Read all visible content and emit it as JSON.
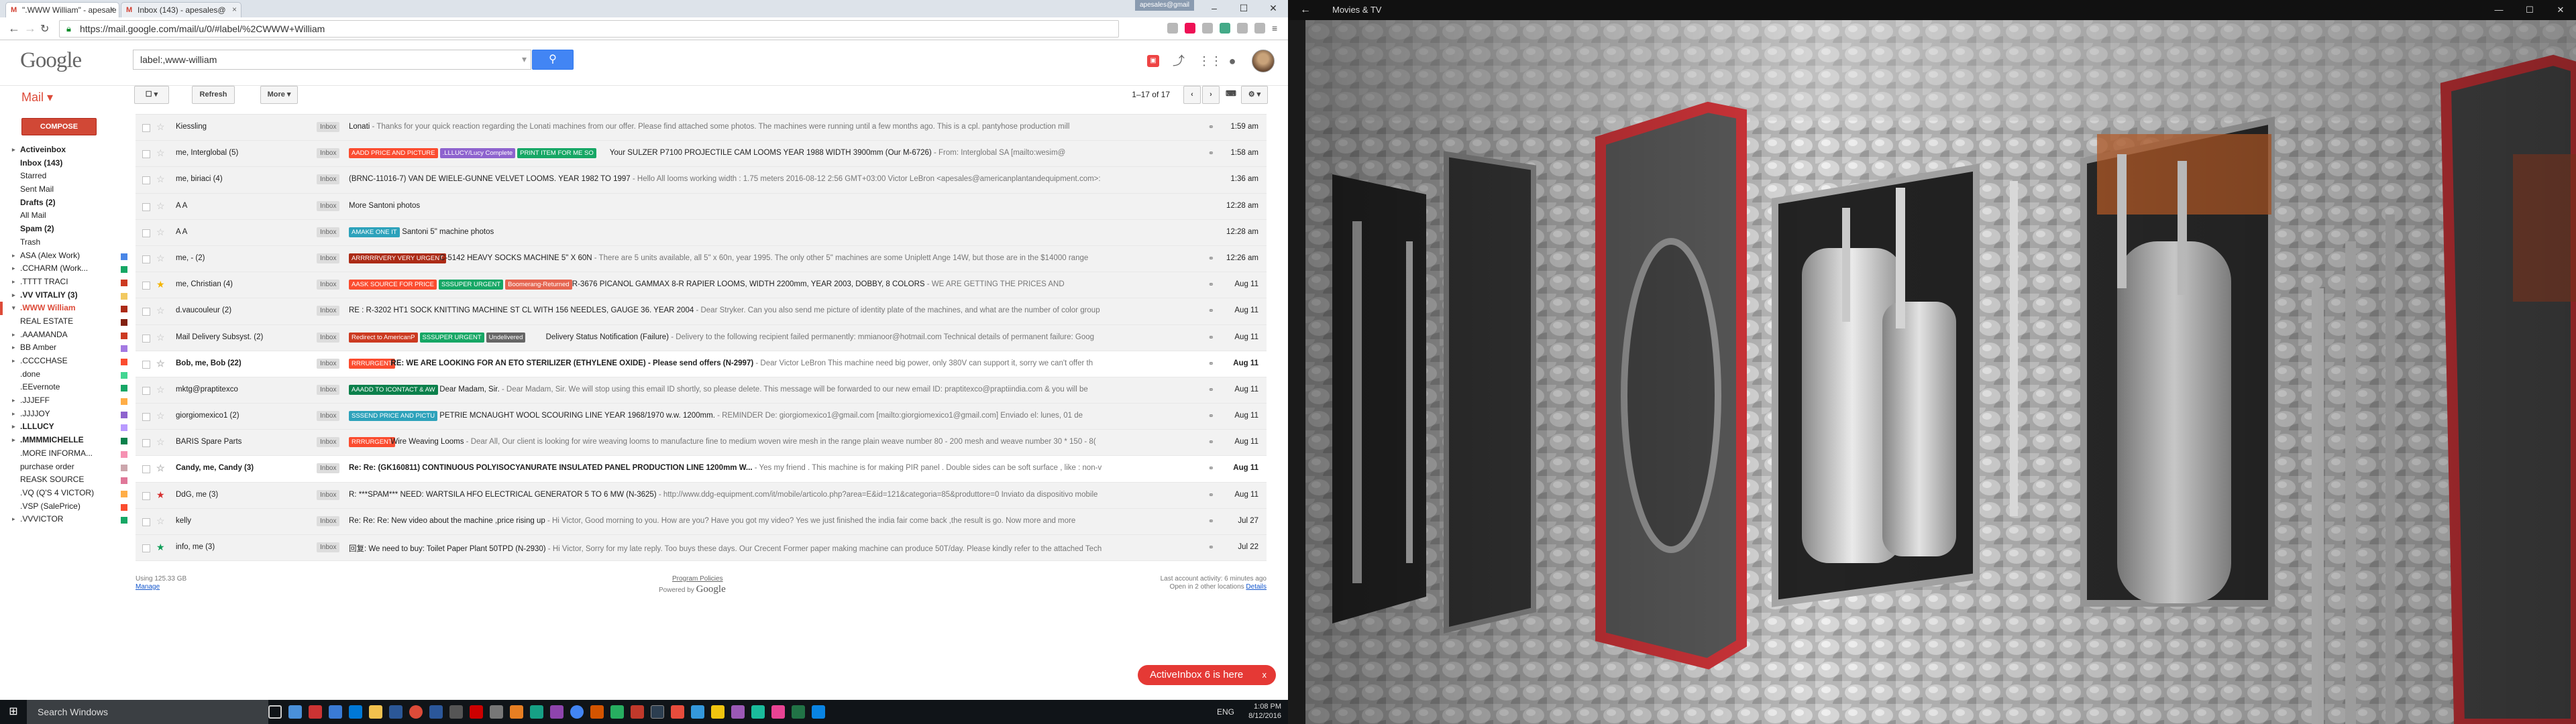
{
  "browser": {
    "tabs": [
      {
        "title": "\".WWW William\" - apesale"
      },
      {
        "title": "Inbox (143) - apesales@"
      }
    ],
    "profile_label": "apesales@gmail",
    "url": "https://mail.google.com/mail/u/0/#label/%2CWWW+William"
  },
  "gmail": {
    "logo": "Google",
    "search_value": "label:,www-william",
    "mail_label": "Mail",
    "compose_label": "COMPOSE",
    "toolbar": {
      "refresh_label": "Refresh",
      "more_label": "More",
      "pager_text": "1–17 of 17"
    },
    "nav": [
      {
        "label": "Activeinbox",
        "cls": "toggle",
        "caret": "▸",
        "color": ""
      },
      {
        "label": "Inbox (143)",
        "cls": "bold",
        "caret": "",
        "color": ""
      },
      {
        "label": "Starred",
        "cls": "",
        "caret": "",
        "color": ""
      },
      {
        "label": "Sent Mail",
        "cls": "",
        "caret": "",
        "color": ""
      },
      {
        "label": "Drafts (2)",
        "cls": "bold",
        "caret": "",
        "color": ""
      },
      {
        "label": "All Mail",
        "cls": "",
        "caret": "",
        "color": ""
      },
      {
        "label": "Spam (2)",
        "cls": "bold",
        "caret": "",
        "color": ""
      },
      {
        "label": "Trash",
        "cls": "",
        "caret": "",
        "color": ""
      },
      {
        "label": "ASA (Alex Work)",
        "cls": "lbl",
        "caret": "▸",
        "color": "#4986e7"
      },
      {
        "label": ".CCHARM (Work...",
        "cls": "lbl",
        "caret": "▸",
        "color": "#16a765"
      },
      {
        "label": ".TTTT TRACI",
        "cls": "lbl",
        "caret": "▸",
        "color": "#cc3a21"
      },
      {
        "label": ".VV VITALIY (3)",
        "cls": "bold",
        "caret": "▸",
        "color": "#f2c960"
      },
      {
        "label": ".WWW William",
        "cls": "sel",
        "caret": "▾",
        "color": "#ac2b16"
      },
      {
        "label": "REAL ESTATE",
        "cls": "lbl",
        "caret": "",
        "color": "#822111"
      },
      {
        "label": ".AAAMANDA",
        "cls": "lbl",
        "caret": "▸",
        "color": "#cc3a21"
      },
      {
        "label": "BB Amber",
        "cls": "lbl",
        "caret": "▸",
        "color": "#a479e2"
      },
      {
        "label": ".CCCCHASE",
        "cls": "lbl",
        "caret": "▸",
        "color": "#fb4c2f"
      },
      {
        "label": ".done",
        "cls": "lbl",
        "caret": "",
        "color": "#42d692"
      },
      {
        "label": ".EEvernote",
        "cls": "lbl",
        "caret": "",
        "color": "#16a766"
      },
      {
        "label": ".JJJEFF",
        "cls": "lbl",
        "caret": "▸",
        "color": "#ffad46"
      },
      {
        "label": ".JJJJOY",
        "cls": "lbl",
        "caret": "▸",
        "color": "#8e63ce"
      },
      {
        "label": ".LLLUCY",
        "cls": "bold",
        "caret": "▸",
        "color": "#b99aff"
      },
      {
        "label": ".MMMMICHELLE",
        "cls": "bold",
        "caret": "▸",
        "color": "#0b804b"
      },
      {
        "label": ".MORE INFORMA...",
        "cls": "lbl",
        "caret": "",
        "color": "#f691b2"
      },
      {
        "label": "purchase order",
        "cls": "lbl",
        "caret": "",
        "color": "#cca6ac"
      },
      {
        "label": "REASK SOURCE",
        "cls": "lbl",
        "caret": "",
        "color": "#e07798"
      },
      {
        "label": ".VQ (Q'S 4 VICTOR)",
        "cls": "lbl",
        "caret": "",
        "color": "#ffad47"
      },
      {
        "label": ".VSP (SalePrice)",
        "cls": "lbl",
        "caret": "",
        "color": "#fb4c2f"
      },
      {
        "label": ".VVVICTOR",
        "cls": "lbl",
        "caret": "▸",
        "color": "#16a765"
      }
    ],
    "emails": [
      {
        "from": "Kiessling",
        "unread": false,
        "star": "",
        "labels": [],
        "subject": "Lonati",
        "snippet": " - Thanks for your quick reaction regarding the Lonati machines from our offer. Please find attached some photos. The machines were running until a few months ago. This is a cpl. pantyhose production mill",
        "clip": true,
        "date": "1:59 am"
      },
      {
        "from": "me, Interglobal (5)",
        "unread": false,
        "star": "",
        "labels": [
          {
            "t": "AADD PRICE AND PICTURE",
            "c": "#fb4c2f"
          },
          {
            "t": ".LLLUCY/Lucy Complete",
            "c": "#8e63ce"
          },
          {
            "t": "PRINT ITEM FOR ME SO",
            "c": "#16a765"
          }
        ],
        "subject": "Your SULZER P7100 PROJECTILE CAM LOOMS YEAR 1988 WIDTH 3900mm (Our M-6726)",
        "snippet": " - From: Interglobal SA [mailto:wesim@",
        "clip": true,
        "date": "1:58 am"
      },
      {
        "from": "me, biriaci (4)",
        "unread": false,
        "star": "",
        "labels": [],
        "subject": "(BRNC-11016-7) VAN DE WIELE-GUNNE VELVET LOOMS. YEAR 1982 TO 1997",
        "snippet": " - Hello All looms working width : 1.75 meters 2016-08-12 2:56 GMT+03:00 Victor LeBron <apesales@americanplantandequipment.com>:",
        "clip": false,
        "date": "1:36 am"
      },
      {
        "from": "A A",
        "unread": false,
        "star": "",
        "labels": [],
        "subject": "More Santoni photos",
        "snippet": "",
        "clip": false,
        "date": "12:28 am"
      },
      {
        "from": "A A",
        "unread": false,
        "star": "",
        "labels": [
          {
            "t": "AMAKE ONE IT",
            "c": "#2da2bb"
          }
        ],
        "subject": "Santoni 5\" machine photos",
        "snippet": "",
        "clip": false,
        "date": "12:28 am"
      },
      {
        "from": "me, - (2)",
        "unread": false,
        "star": "",
        "labels": [
          {
            "t": "ARRRRRVERY VERY URGENT",
            "c": "#ac2b16"
          }
        ],
        "subject": "C-5142 HEAVY SOCKS MACHINE 5\" X 60N",
        "snippet": " - There are 5 units available, all 5\" x 60n, year 1995. The only other 5\" machines are some Uniplett Ange 14W, but those are in the $14000 range",
        "clip": true,
        "date": "12:26 am"
      },
      {
        "from": "me, Christian (4)",
        "unread": false,
        "star": "yellow",
        "labels": [
          {
            "t": "AASK SOURCE FOR PRICE",
            "c": "#fb4c2f"
          },
          {
            "t": "SSSUPER URGENT",
            "c": "#16a765"
          },
          {
            "t": "Boomerang-Returned",
            "c": "#e66550"
          }
        ],
        "subject": "R-3676 PICANOL GAMMAX 8-R RAPIER LOOMS, WIDTH 2200mm, YEAR 2003, DOBBY, 8 COLORS",
        "snippet": " - WE ARE GETTING THE PRICES AND",
        "clip": true,
        "date": "Aug 11"
      },
      {
        "from": "d.vaucouleur (2)",
        "unread": false,
        "star": "",
        "labels": [],
        "subject": "RE : R-3202 HT1 SOCK KNITTING MACHINE ST CL WITH 156 NEEDLES, GAUGE 36. YEAR 2004",
        "snippet": " - Dear Stryker. Can you also send me picture of identity plate of the machines, and what are the number of color group",
        "clip": true,
        "date": "Aug 11"
      },
      {
        "from": "Mail Delivery Subsyst. (2)",
        "unread": false,
        "star": "",
        "labels": [
          {
            "t": "Redirect to AmericanP",
            "c": "#cc3a21"
          },
          {
            "t": "SSSUPER URGENT",
            "c": "#16a765"
          },
          {
            "t": "Undelivered",
            "c": "#666666"
          }
        ],
        "subject": "Delivery Status Notification (Failure)",
        "snippet": " - Delivery to the following recipient failed permanently: mmianoor@hotmail.com Technical details of permanent failure: Goog",
        "clip": true,
        "date": "Aug 11"
      },
      {
        "from": "Bob, me, Bob (22)",
        "unread": true,
        "star": "",
        "labels": [
          {
            "t": "RRRURGENT",
            "c": "#fb4c2f"
          }
        ],
        "subject": "RE: WE ARE LOOKING FOR AN ETO STERILIZER (ETHYLENE OXIDE) - Please send offers (N-2997)",
        "snippet": " - Dear Victor LeBron This machine need big power, only 380V can support it, sorry we can't offer th",
        "clip": true,
        "date": "Aug 11"
      },
      {
        "from": "mktg@praptitexco",
        "unread": false,
        "star": "",
        "labels": [
          {
            "t": "AAADD TO ICONTACT & AW",
            "c": "#0b804b"
          }
        ],
        "subject": "Dear Madam, Sir.",
        "snippet": " - Dear Madam, Sir. We will stop using this email ID shortly, so please delete. This message will be forwarded to our new email ID: praptitexco@praptiindia.com & you will be",
        "clip": true,
        "date": "Aug 11"
      },
      {
        "from": "giorgiomexico1 (2)",
        "unread": false,
        "star": "",
        "labels": [
          {
            "t": "SSSEND PRICE AND PICTU",
            "c": "#2da2bb"
          }
        ],
        "subject": "PETRIE MCNAUGHT WOOL SCOURING LINE YEAR 1968/1970 w.w. 1200mm.",
        "snippet": " - REMINDER De: giorgiomexico1@gmail.com [mailto:giorgiomexico1@gmail.com] Enviado el: lunes, 01 de",
        "clip": true,
        "date": "Aug 11"
      },
      {
        "from": "BARIS Spare Parts",
        "unread": false,
        "star": "",
        "labels": [
          {
            "t": "RRRURGENT",
            "c": "#fb4c2f"
          }
        ],
        "subject": "Wire Weaving Looms",
        "snippet": " - Dear All, Our client is looking for wire weaving looms to manufacture fine to medium woven wire mesh in the range plain weave number 80 - 200 mesh and weave number 30 * 150 - 8(",
        "clip": true,
        "date": "Aug 11"
      },
      {
        "from": "Candy, me, Candy (3)",
        "unread": true,
        "star": "",
        "labels": [],
        "subject": "Re: Re: (GK160811) CONTINUOUS POLYISOCYANURATE INSULATED PANEL PRODUCTION LINE 1200mm W...",
        "snippet": " - Yes my friend . This machine is for making PIR panel . Double sides can be soft surface , like : non-v",
        "clip": true,
        "date": "Aug 11"
      },
      {
        "from": "DdG, me (3)",
        "unread": false,
        "star": "red",
        "labels": [],
        "subject": "R: ***SPAM*** NEED: WARTSILA HFO ELECTRICAL GENERATOR 5 TO 6 MW (N-3625)",
        "snippet": " - http://www.ddg-equipment.com/it/mobile/articolo.php?area=E&id=121&categoria=85&produttore=0 Inviato da dispositivo mobile",
        "clip": true,
        "date": "Aug 11"
      },
      {
        "from": "kelly",
        "unread": false,
        "star": "",
        "labels": [],
        "subject": "Re: Re: Re: New video about the machine ,price rising up",
        "snippet": " - Hi Victor, Good morning to you. How are you? Have you got my video? Yes we just finished the india fair come back ,the result is go. Now more and more",
        "clip": true,
        "date": "Jul 27"
      },
      {
        "from": "info, me (3)",
        "unread": false,
        "star": "green",
        "labels": [],
        "subject": "回复: We need to buy: Toilet Paper Plant 50TPD (N-2930)",
        "snippet": " - Hi Victor, Sorry for my late reply. Too buys these days. Our Crecent Former paper making machine can produce 50T/day. Please kindly refer to the attached Tech",
        "clip": true,
        "date": "Jul 22"
      }
    ],
    "footer": {
      "usage": "Using 125.33 GB",
      "manage": "Manage",
      "program_policies": "Program Policies",
      "powered_by": "Powered by",
      "powered_logo": "Google",
      "last_activity": "Last account activity: 6 minutes ago",
      "open_locations": "Open in 2 other locations",
      "details": "Details"
    },
    "notification": {
      "text": "ActiveInbox 6 is here",
      "close": "x"
    }
  },
  "taskbar": {
    "search_placeholder": "Search Windows",
    "lang": "ENG",
    "time": "1:08 PM",
    "date": "8/12/2016"
  },
  "movies": {
    "title": "Movies & TV",
    "back": "←",
    "minimize": "—",
    "maximize": "☐",
    "close": "✕"
  }
}
